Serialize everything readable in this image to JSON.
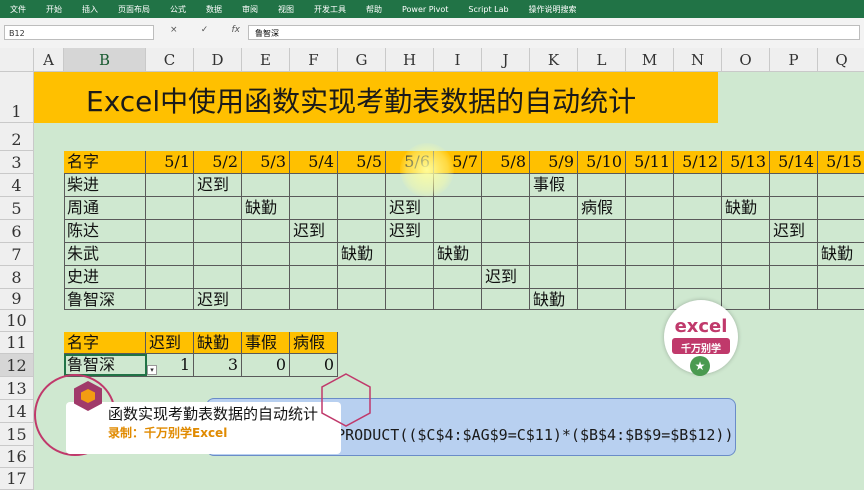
{
  "ribbon": {
    "tabs": [
      "文件",
      "开始",
      "插入",
      "页面布局",
      "公式",
      "数据",
      "审阅",
      "视图",
      "开发工具",
      "帮助",
      "Power Pivot",
      "Script Lab",
      "操作说明搜索"
    ]
  },
  "formula_bar": {
    "name_box": "B12",
    "fx": "fx",
    "cancel": "×",
    "confirm": "✓",
    "value": "鲁智深"
  },
  "columns": [
    "A",
    "B",
    "C",
    "D",
    "E",
    "F",
    "G",
    "H",
    "I",
    "J",
    "K",
    "L",
    "M",
    "N",
    "O",
    "P",
    "Q"
  ],
  "rows": [
    "1",
    "2",
    "3",
    "4",
    "5",
    "6",
    "7",
    "8",
    "9",
    "10",
    "11",
    "12",
    "13",
    "14",
    "15",
    "16",
    "17"
  ],
  "title": "Excel中使用函数实现考勤表数据的自动统计",
  "attendance": {
    "header_label": "名字",
    "dates": [
      "5/1",
      "5/2",
      "5/3",
      "5/4",
      "5/5",
      "5/6",
      "5/7",
      "5/8",
      "5/9",
      "5/10",
      "5/11",
      "5/12",
      "5/13",
      "5/14",
      "5/15"
    ],
    "rows": [
      {
        "name": "柴进",
        "cells": [
          "",
          "迟到",
          "",
          "",
          "",
          "",
          "",
          "",
          "事假",
          "",
          "",
          "",
          "",
          "",
          ""
        ]
      },
      {
        "name": "周通",
        "cells": [
          "",
          "",
          "缺勤",
          "",
          "",
          "迟到",
          "",
          "",
          "",
          "病假",
          "",
          "",
          "缺勤",
          "",
          ""
        ]
      },
      {
        "name": "陈达",
        "cells": [
          "",
          "",
          "",
          "迟到",
          "",
          "迟到",
          "",
          "",
          "",
          "",
          "",
          "",
          "",
          "迟到",
          ""
        ]
      },
      {
        "name": "朱武",
        "cells": [
          "",
          "",
          "",
          "",
          "缺勤",
          "",
          "缺勤",
          "",
          "",
          "",
          "",
          "",
          "",
          "",
          "缺勤"
        ]
      },
      {
        "name": "史进",
        "cells": [
          "",
          "",
          "",
          "",
          "",
          "",
          "",
          "迟到",
          "",
          "",
          "",
          "",
          "",
          "",
          ""
        ]
      },
      {
        "name": "鲁智深",
        "cells": [
          "",
          "迟到",
          "",
          "",
          "",
          "",
          "",
          "",
          "缺勤",
          "",
          "",
          "",
          "",
          "",
          ""
        ]
      }
    ]
  },
  "summary": {
    "headers": [
      "名字",
      "迟到",
      "缺勤",
      "事假",
      "病假"
    ],
    "row": [
      "鲁智深",
      "1",
      "3",
      "0",
      "0"
    ]
  },
  "formula_tip": "=SUMPRODUCT(($C$4:$AG$9=C$11)*($B$4:$B$9=$B$12))",
  "overlay": {
    "title": "函数实现考勤表数据的自动统计",
    "subtitle": "录制：千万别学Excel"
  },
  "badge": {
    "line1": "excel",
    "line2": "千万别学"
  },
  "colors": {
    "ribbon": "#217346",
    "header_fill": "#ffc000",
    "sheet_bg": "#cfe8d0",
    "tip_bg": "#b8d0f0"
  }
}
